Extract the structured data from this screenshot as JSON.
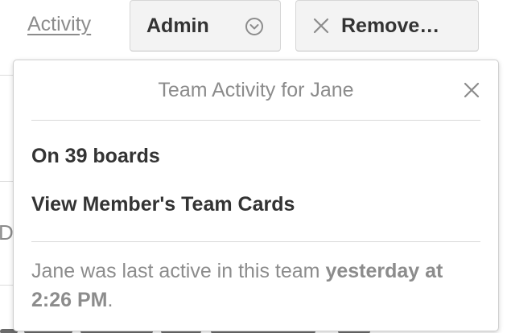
{
  "top_bar": {
    "activity_link": "Activity",
    "admin_button": "Admin",
    "remove_button": "Remove…"
  },
  "background": {
    "fragment_letter": "D"
  },
  "popover": {
    "title": "Team Activity for Jane",
    "boards_item": "On 39 boards",
    "team_cards_item": "View Member's Team Cards",
    "footer_prefix": "Jane was last active in this team ",
    "footer_time": "yesterday at 2:26 PM",
    "footer_suffix": "."
  },
  "icons": {
    "admin_chevron": "chevron-down-circle-icon",
    "remove_x": "close-icon",
    "popover_close": "close-icon"
  },
  "colors": {
    "muted_text": "#8c8c8c",
    "strong_text": "#333333",
    "button_bg": "#f3f3f3",
    "border": "#d6d6d6"
  }
}
